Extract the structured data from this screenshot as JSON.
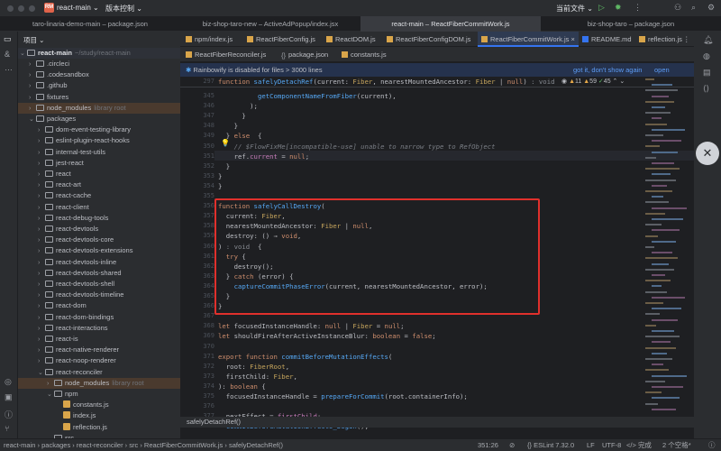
{
  "titlebar": {
    "project_badge": "RM",
    "project": "react-main",
    "vcs": "版本控制",
    "run_config": "当前文件"
  },
  "window_tabs": [
    "taro-linaria-demo-main – package.json",
    "biz-shop-taro-new – ActiveAdPopup/index.jsx",
    "react-main – ReactFiberCommitWork.js",
    "biz-shop-taro – package.json"
  ],
  "sidebar": {
    "header": "项目",
    "root": {
      "name": "react-main",
      "hint": "~/study/react-main"
    },
    "items": [
      {
        "name": ".circleci",
        "depth": 1
      },
      {
        "name": ".codesandbox",
        "depth": 1
      },
      {
        "name": ".github",
        "depth": 1
      },
      {
        "name": "fixtures",
        "depth": 1
      },
      {
        "name": "node_modules",
        "depth": 1,
        "hint": "library root"
      },
      {
        "name": "packages",
        "depth": 1,
        "open": true
      },
      {
        "name": "dom-event-testing-library",
        "depth": 2
      },
      {
        "name": "eslint-plugin-react-hooks",
        "depth": 2
      },
      {
        "name": "internal-test-utils",
        "depth": 2
      },
      {
        "name": "jest-react",
        "depth": 2
      },
      {
        "name": "react",
        "depth": 2
      },
      {
        "name": "react-art",
        "depth": 2
      },
      {
        "name": "react-cache",
        "depth": 2
      },
      {
        "name": "react-client",
        "depth": 2
      },
      {
        "name": "react-debug-tools",
        "depth": 2
      },
      {
        "name": "react-devtools",
        "depth": 2
      },
      {
        "name": "react-devtools-core",
        "depth": 2
      },
      {
        "name": "react-devtools-extensions",
        "depth": 2
      },
      {
        "name": "react-devtools-inline",
        "depth": 2
      },
      {
        "name": "react-devtools-shared",
        "depth": 2
      },
      {
        "name": "react-devtools-shell",
        "depth": 2
      },
      {
        "name": "react-devtools-timeline",
        "depth": 2
      },
      {
        "name": "react-dom",
        "depth": 2
      },
      {
        "name": "react-dom-bindings",
        "depth": 2
      },
      {
        "name": "react-interactions",
        "depth": 2
      },
      {
        "name": "react-is",
        "depth": 2
      },
      {
        "name": "react-native-renderer",
        "depth": 2
      },
      {
        "name": "react-noop-renderer",
        "depth": 2
      },
      {
        "name": "react-reconciler",
        "depth": 2,
        "open": true
      },
      {
        "name": "node_modules",
        "depth": 3,
        "hint": "library root"
      },
      {
        "name": "npm",
        "depth": 3,
        "open": true
      },
      {
        "name": "constants.js",
        "depth": 4,
        "file": true
      },
      {
        "name": "index.js",
        "depth": 4,
        "file": true
      },
      {
        "name": "reflection.js",
        "depth": 4,
        "file": true
      },
      {
        "name": "src",
        "depth": 3,
        "open": true
      }
    ]
  },
  "editor_tabs_row1": [
    "npm/index.js",
    "ReactFiberConfig.js",
    "ReactDOM.js",
    "ReactFiberConfigDOM.js",
    "ReactFiberCommitWork.js",
    "README.md",
    "reflection.js"
  ],
  "editor_tabs_row2": [
    "ReactFiberReconciler.js",
    "package.json",
    "constants.js"
  ],
  "active_tab": "ReactFiberCommitWork.js",
  "banner": {
    "message": "Rainbowify is disabled for files > 3000 lines",
    "action1": "got it, don't show again",
    "action2": "open settings"
  },
  "inspections": {
    "warnings": "11",
    "weak_warnings": "59",
    "ok": "45"
  },
  "sticky": {
    "line": "297",
    "hint": ": void"
  },
  "code_lines": [
    {
      "n": "345",
      "t": [
        [
          "",
          "          "
        ],
        [
          "fn",
          "getComponentNameFromFiber"
        ],
        [
          "",
          "(current),"
        ]
      ]
    },
    {
      "n": "346",
      "t": [
        [
          "",
          "        );"
        ]
      ]
    },
    {
      "n": "347",
      "t": [
        [
          "",
          "      }"
        ]
      ]
    },
    {
      "n": "348",
      "t": [
        [
          "",
          "    }"
        ]
      ]
    },
    {
      "n": "349",
      "t": [
        [
          "",
          "  } "
        ],
        [
          "kw",
          "else"
        ],
        [
          "",
          "  {"
        ]
      ]
    },
    {
      "n": "350",
      "t": [
        [
          "cm",
          "    // $FlowFixMe[incompatible-use] unable to narrow type to RefObject"
        ]
      ]
    },
    {
      "n": "351",
      "t": [
        [
          "",
          "    ref."
        ],
        [
          "pl",
          "current"
        ],
        [
          "",
          " = "
        ],
        [
          "kw",
          "null"
        ],
        [
          "",
          ";"
        ]
      ]
    },
    {
      "n": "352",
      "t": [
        [
          "",
          "  }"
        ]
      ]
    },
    {
      "n": "353",
      "t": [
        [
          "",
          "}"
        ]
      ]
    },
    {
      "n": "354",
      "t": [
        [
          "",
          "}"
        ]
      ]
    },
    {
      "n": "355",
      "t": [
        [
          "",
          ""
        ]
      ]
    },
    {
      "n": "356",
      "t": [
        [
          "kw",
          "function "
        ],
        [
          "fn",
          "safelyCallDestroy"
        ],
        [
          "",
          "("
        ]
      ]
    },
    {
      "n": "357",
      "t": [
        [
          "",
          "  current: "
        ],
        [
          "ty",
          "Fiber"
        ],
        [
          "",
          ","
        ]
      ]
    },
    {
      "n": "358",
      "t": [
        [
          "",
          "  nearestMountedAncestor: "
        ],
        [
          "ty",
          "Fiber"
        ],
        [
          "",
          " | "
        ],
        [
          "kw",
          "null"
        ],
        [
          "",
          ","
        ]
      ]
    },
    {
      "n": "359",
      "t": [
        [
          "",
          "  destroy: () ⇒ "
        ],
        [
          "kw",
          "void"
        ],
        [
          "",
          ","
        ]
      ]
    },
    {
      "n": "360",
      "t": [
        [
          "",
          ") "
        ],
        [
          "hn",
          ": void"
        ],
        [
          "",
          "  {"
        ]
      ]
    },
    {
      "n": "361",
      "t": [
        [
          "kw",
          "  try"
        ],
        [
          "",
          " {"
        ]
      ]
    },
    {
      "n": "362",
      "t": [
        [
          "",
          "    destroy();"
        ]
      ]
    },
    {
      "n": "363",
      "t": [
        [
          "",
          "  } "
        ],
        [
          "kw",
          "catch"
        ],
        [
          "",
          " (error) {"
        ]
      ]
    },
    {
      "n": "364",
      "t": [
        [
          "",
          "    "
        ],
        [
          "fn",
          "captureCommitPhaseError"
        ],
        [
          "",
          "(current, nearestMountedAncestor, error);"
        ]
      ]
    },
    {
      "n": "365",
      "t": [
        [
          "",
          "  }"
        ]
      ]
    },
    {
      "n": "366",
      "t": [
        [
          "",
          "}"
        ]
      ]
    },
    {
      "n": "367",
      "t": [
        [
          "",
          ""
        ]
      ]
    },
    {
      "n": "368",
      "t": [
        [
          "kw",
          "let "
        ],
        [
          "",
          "focusedInstanceHandle: "
        ],
        [
          "kw",
          "null"
        ],
        [
          "",
          " | "
        ],
        [
          "ty",
          "Fiber"
        ],
        [
          "",
          " = "
        ],
        [
          "kw",
          "null"
        ],
        [
          "",
          ";"
        ]
      ]
    },
    {
      "n": "369",
      "t": [
        [
          "kw",
          "let "
        ],
        [
          "",
          "shouldFireAfterActiveInstanceBlur: "
        ],
        [
          "kw",
          "boolean"
        ],
        [
          "",
          " = "
        ],
        [
          "kw",
          "false"
        ],
        [
          "",
          ";"
        ]
      ]
    },
    {
      "n": "370",
      "t": [
        [
          "",
          ""
        ]
      ]
    },
    {
      "n": "371",
      "t": [
        [
          "kw",
          "export function "
        ],
        [
          "fn",
          "commitBeforeMutationEffects"
        ],
        [
          "",
          "("
        ]
      ]
    },
    {
      "n": "372",
      "t": [
        [
          "",
          "  root: "
        ],
        [
          "ty",
          "FiberRoot"
        ],
        [
          "",
          ","
        ]
      ]
    },
    {
      "n": "373",
      "t": [
        [
          "",
          "  firstChild: "
        ],
        [
          "ty",
          "Fiber"
        ],
        [
          "",
          ","
        ]
      ]
    },
    {
      "n": "374",
      "t": [
        [
          "",
          "): "
        ],
        [
          "kw",
          "boolean"
        ],
        [
          "",
          " {"
        ]
      ]
    },
    {
      "n": "375",
      "t": [
        [
          "",
          "  focusedInstanceHandle = "
        ],
        [
          "fn",
          "prepareForCommit"
        ],
        [
          "",
          "(root.containerInfo);"
        ]
      ]
    },
    {
      "n": "376",
      "t": [
        [
          "",
          ""
        ]
      ]
    },
    {
      "n": "377",
      "t": [
        [
          "",
          "  nextEffect = "
        ],
        [
          "pl",
          "firstChild"
        ],
        [
          "",
          ";"
        ]
      ]
    },
    {
      "n": "378",
      "t": [
        [
          "",
          "  "
        ],
        [
          "fn",
          "commitBeforeMutationEffects_begin"
        ],
        [
          "",
          "();"
        ]
      ]
    }
  ],
  "crumb_hint": "safelyDetachRef()",
  "statusbar": {
    "path": [
      "react-main",
      "packages",
      "react-reconciler",
      "src",
      "ReactFiberCommitWork.js",
      "safelyDetachRef()"
    ],
    "position": "351:26",
    "linter": "ESLint 7.32.0",
    "line_sep": "LF",
    "encoding": "UTF-8",
    "ai_status": "完成",
    "indent": "2 个空格*"
  },
  "colors": {
    "accent": "#3574f0",
    "highlight_box": "#e0302c",
    "background": "#1e1f22",
    "panel": "#2b2d30"
  }
}
